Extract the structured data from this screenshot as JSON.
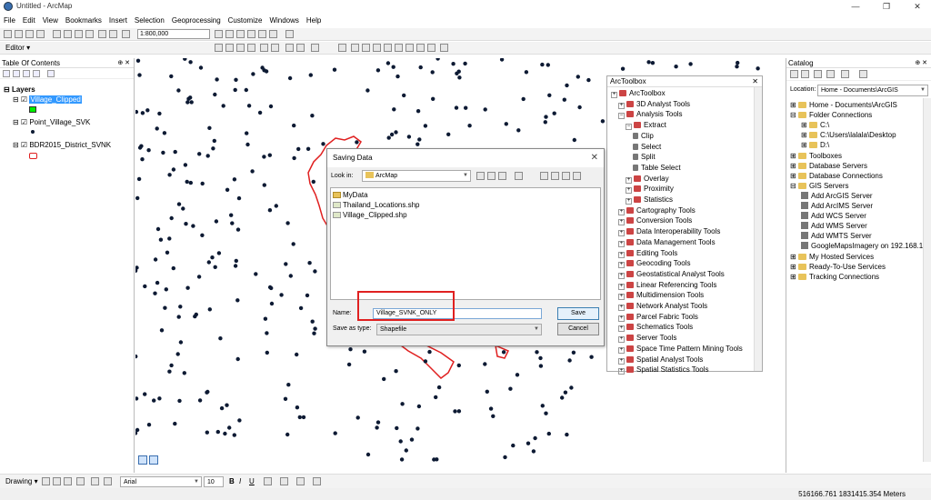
{
  "window": {
    "title": "Untitled - ArcMap",
    "minimize": "—",
    "restore": "❐",
    "close": "✕"
  },
  "menu": [
    "File",
    "Edit",
    "View",
    "Bookmarks",
    "Insert",
    "Selection",
    "Geoprocessing",
    "Customize",
    "Windows",
    "Help"
  ],
  "toolbar": {
    "scale": "1:800,000",
    "editor_label": "Editor ▾"
  },
  "toc": {
    "title": "Table Of Contents",
    "pin": "⊕ ✕",
    "group": "Layers",
    "layers": [
      "Village_Clipped",
      "Point_Village_SVK",
      "BDR2015_District_SVNK"
    ],
    "colors": {
      "village_clipped": "#00ee00",
      "district": "#e02020"
    }
  },
  "toolbox": {
    "title": "ArcToolbox",
    "close": "✕",
    "items": [
      "ArcToolbox",
      "3D Analyst Tools",
      "Analysis Tools",
      "Extract",
      "Clip",
      "Select",
      "Split",
      "Table Select",
      "Overlay",
      "Proximity",
      "Statistics",
      "Cartography Tools",
      "Conversion Tools",
      "Data Interoperability Tools",
      "Data Management Tools",
      "Editing Tools",
      "Geocoding Tools",
      "Geostatistical Analyst Tools",
      "Linear Referencing Tools",
      "Multidimension Tools",
      "Network Analyst Tools",
      "Parcel Fabric Tools",
      "Schematics Tools",
      "Server Tools",
      "Space Time Pattern Mining Tools",
      "Spatial Analyst Tools",
      "Spatial Statistics Tools"
    ]
  },
  "catalog": {
    "title": "Catalog",
    "location_label": "Location:",
    "location_value": "Home - Documents\\ArcGIS",
    "items": [
      "Home - Documents\\ArcGIS",
      "Folder Connections",
      "C:\\",
      "C:\\Users\\lalala\\Desktop",
      "D:\\",
      "Toolboxes",
      "Database Servers",
      "Database Connections",
      "GIS Servers",
      "Add ArcGIS Server",
      "Add ArcIMS Server",
      "Add WCS Server",
      "Add WMS Server",
      "Add WMTS Server",
      "GoogleMapsImagery on 192.168.1.1",
      "My Hosted Services",
      "Ready-To-Use Services",
      "Tracking Connections"
    ]
  },
  "dialog": {
    "title": "Saving Data",
    "close": "✕",
    "look_in_label": "Look in:",
    "look_in_value": "ArcMap",
    "files": [
      "MyData",
      "Thailand_Locations.shp",
      "Village_Clipped.shp"
    ],
    "name_label": "Name:",
    "name_value": "Village_SVNK_ONLY",
    "type_label": "Save as type:",
    "type_value": "Shapefile",
    "save": "Save",
    "cancel": "Cancel"
  },
  "drawing": {
    "label": "Drawing ▾",
    "font": "Arial",
    "size": "10",
    "bold": "B",
    "italic": "I",
    "underline": "U"
  },
  "status": {
    "coords": "516166.761  1831415.354 Meters"
  },
  "colors": {
    "accent": "#3399ff",
    "points": "#0d1a33",
    "boundary": "#e02020",
    "highlight": "#e02020"
  }
}
